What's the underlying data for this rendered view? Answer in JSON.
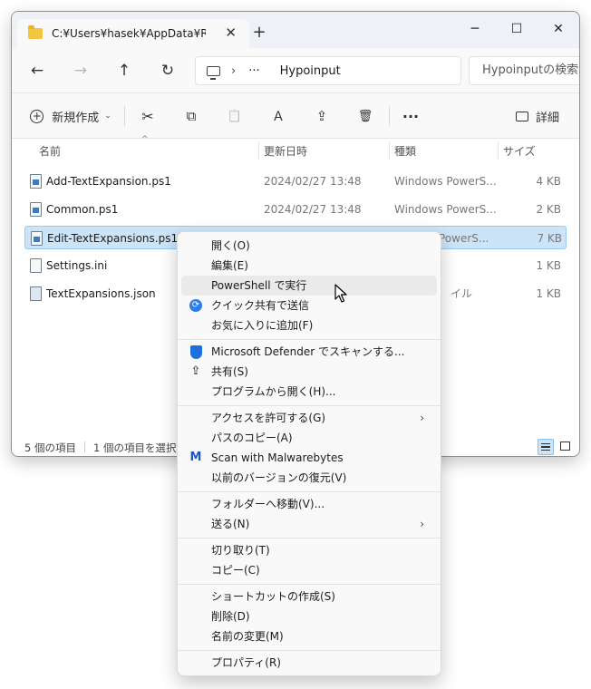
{
  "window": {
    "tab_title": "C:¥Users¥hasek¥AppData¥Roa",
    "tab_close": "✕",
    "new_tab": "+",
    "minimize": "─",
    "maximize": "☐",
    "close": "✕"
  },
  "nav": {
    "back": "←",
    "forward": "→",
    "up": "↑",
    "refresh": "↻",
    "address_sep": "›",
    "address_dots": "···",
    "address_folder": "Hypoinput",
    "search_placeholder": "Hypoinputの検索"
  },
  "toolbar": {
    "new_label": "新規作成",
    "new_chevron": "⌄",
    "cut": "✂",
    "copy": "⧉",
    "paste": "📋",
    "rename": "Ａ",
    "share": "⇪",
    "delete": "🗑",
    "more": "···",
    "details_label": "詳細"
  },
  "columns": {
    "name": "名前",
    "sort_arrow": "^",
    "date": "更新日時",
    "type": "種類",
    "size": "サイズ"
  },
  "files": [
    {
      "name": "Add-TextExpansion.ps1",
      "date": "2024/02/27 13:48",
      "type": "Windows PowerS...",
      "size": "4 KB",
      "icon": "powershell-file"
    },
    {
      "name": "Common.ps1",
      "date": "2024/02/27 13:48",
      "type": "Windows PowerS...",
      "size": "2 KB",
      "icon": "powershell-file"
    },
    {
      "name": "Edit-TextExpansions.ps1",
      "date": "",
      "type": "PowerS...",
      "size": "7 KB",
      "icon": "powershell-file",
      "selected": true
    },
    {
      "name": "Settings.ini",
      "date": "",
      "type": "",
      "size": "1 KB",
      "icon": "settings-file"
    },
    {
      "name": "TextExpansions.json",
      "date": "",
      "type": "イル",
      "size": "1 KB",
      "icon": "json-file"
    }
  ],
  "status": {
    "item_count": "5 個の項目",
    "selected_count": "1 個の項目を選択"
  },
  "context_menu": {
    "items": [
      {
        "label": "開く(O)",
        "icon": ""
      },
      {
        "label": "編集(E)",
        "icon": ""
      },
      {
        "label": "PowerShell で実行",
        "icon": ""
      },
      {
        "label": "クイック共有で送信",
        "icon": "quick-share-icon"
      },
      {
        "label": "お気に入りに追加(F)",
        "icon": ""
      },
      {
        "label": "Microsoft Defender でスキャンする...",
        "icon": "defender-shield-icon"
      },
      {
        "label": "共有(S)",
        "icon": "share-icon"
      },
      {
        "label": "プログラムから開く(H)...",
        "icon": ""
      },
      {
        "label": "アクセスを許可する(G)",
        "icon": "",
        "submenu": true
      },
      {
        "label": "パスのコピー(A)",
        "icon": ""
      },
      {
        "label": "Scan with Malwarebytes",
        "icon": "malwarebytes-icon"
      },
      {
        "label": "以前のバージョンの復元(V)",
        "icon": ""
      },
      {
        "label": "フォルダーへ移動(V)...",
        "icon": ""
      },
      {
        "label": "送る(N)",
        "icon": "",
        "submenu": true
      },
      {
        "label": "切り取り(T)",
        "icon": ""
      },
      {
        "label": "コピー(C)",
        "icon": ""
      },
      {
        "label": "ショートカットの作成(S)",
        "icon": ""
      },
      {
        "label": "削除(D)",
        "icon": ""
      },
      {
        "label": "名前の変更(M)",
        "icon": ""
      },
      {
        "label": "プロパティ(R)",
        "icon": ""
      }
    ],
    "submenu_arrow": "›",
    "hovered_index": 2
  },
  "colors": {
    "selection_bg": "#cce4f7",
    "accent": "#0067c0",
    "menu_bg": "#f9f9f9"
  }
}
